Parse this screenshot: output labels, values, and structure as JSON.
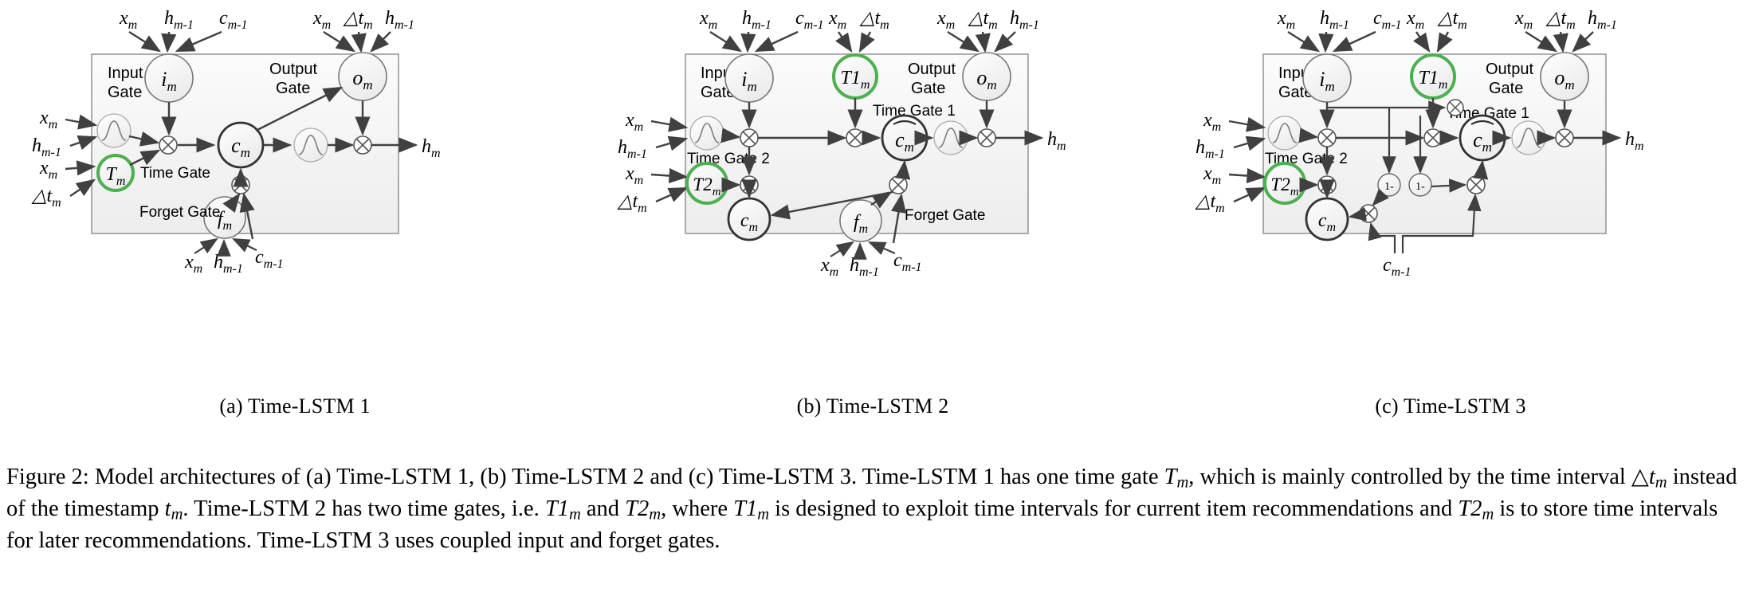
{
  "figure": {
    "number": "Figure 2:",
    "caption_text": "Model architectures of (a) Time-LSTM 1, (b) Time-LSTM 2 and (c) Time-LSTM 3. Time-LSTM 1 has one time gate Tm, which is mainly controlled by the time interval △tm instead of the timestamp tm. Time-LSTM 2 has two time gates, i.e. T1m and T2m, where T1m is designed to exploit time intervals for current item recommendations and T2m is to store time intervals for later recommendations. Time-LSTM 3 uses coupled input and forget gates.",
    "caption_segments": [
      {
        "t": "Figure 2: Model architectures of (a) Time-LSTM 1, (b) Time-LSTM 2 and (c) Time-LSTM 3. Time-LSTM 1 has one time gate ",
        "i": false
      },
      {
        "t": "T",
        "i": true
      },
      {
        "t": "m",
        "sub": true
      },
      {
        "t": ", which is mainly controlled by the time interval ",
        "i": false
      },
      {
        "t": "△t",
        "i": true
      },
      {
        "t": "m",
        "sub": true
      },
      {
        "t": " instead of the timestamp ",
        "i": false
      },
      {
        "t": "t",
        "i": true
      },
      {
        "t": "m",
        "sub": true
      },
      {
        "t": ". Time-LSTM 2 has two time gates, i.e. ",
        "i": false
      },
      {
        "t": "T1",
        "i": true
      },
      {
        "t": "m",
        "sub": true
      },
      {
        "t": " and ",
        "i": false
      },
      {
        "t": "T2",
        "i": true
      },
      {
        "t": "m",
        "sub": true
      },
      {
        "t": ", where ",
        "i": false
      },
      {
        "t": "T1",
        "i": true
      },
      {
        "t": "m",
        "sub": true
      },
      {
        "t": " is designed to exploit time intervals for current item recommendations and ",
        "i": false
      },
      {
        "t": "T2",
        "i": true
      },
      {
        "t": "m",
        "sub": true
      },
      {
        "t": " is to store time intervals for later recommendations. Time-LSTM 3 uses coupled input and forget gates.",
        "i": false
      }
    ]
  },
  "colors": {
    "green_highlight": "#4caf50",
    "cell_fill": "#f2f2f2",
    "node_stroke": "#595959",
    "arrow": "#404040",
    "cell_border": "#808080"
  },
  "symbols": {
    "x": "x",
    "h_prev": "h",
    "c_prev": "c",
    "dt": "△t",
    "h_out": "h",
    "sub_m": "m",
    "sub_m1": "m-1",
    "one_minus": "1-",
    "times": "⊗"
  },
  "panels": [
    {
      "id": "a",
      "caption": "(a) Time-LSTM 1",
      "labels": {
        "input_gate": "Input\nGate",
        "input_gate_line1": "Input",
        "input_gate_line2": "Gate",
        "output_gate": "Output\nGate",
        "output_gate_line1": "Output",
        "output_gate_line2": "Gate",
        "time_gate": "Time Gate",
        "forget_gate": "Forget Gate"
      },
      "nodes": {
        "i": "i",
        "o": "o",
        "c": "c",
        "f": "f",
        "T": "T"
      },
      "top_inputs_left": [
        "x",
        "h",
        "c"
      ],
      "top_inputs_right": [
        "x",
        "△t",
        "h"
      ],
      "left_inputs_top": [
        "x",
        "h"
      ],
      "left_inputs_bottom": [
        "x",
        "△t"
      ],
      "bottom_inputs": [
        "x",
        "h",
        "c"
      ],
      "output": "h"
    },
    {
      "id": "b",
      "caption": "(b) Time-LSTM 2",
      "labels": {
        "input_gate_line1": "Input",
        "input_gate_line2": "Gate",
        "output_gate_line1": "Output",
        "output_gate_line2": "Gate",
        "time_gate_1": "Time Gate 1",
        "time_gate_2": "Time Gate 2",
        "forget_gate": "Forget Gate"
      },
      "nodes": {
        "i": "i",
        "o": "o",
        "c_tilde": "c",
        "c": "c",
        "f": "f",
        "T1": "T1",
        "T2": "T2"
      },
      "top_inputs_i": [
        "x",
        "h",
        "c"
      ],
      "top_inputs_T1": [
        "x",
        "△t"
      ],
      "top_inputs_o": [
        "x",
        "△t",
        "h"
      ],
      "left_inputs_top": [
        "x",
        "h"
      ],
      "left_inputs_bottom": [
        "x",
        "△t"
      ],
      "bottom_inputs": [
        "x",
        "h",
        "c"
      ],
      "output": "h"
    },
    {
      "id": "c",
      "caption": "(c) Time-LSTM 3",
      "labels": {
        "input_gate_line1": "Input",
        "input_gate_line2": "Gate",
        "output_gate_line1": "Output",
        "output_gate_line2": "Gate",
        "time_gate_1": "Time Gate 1",
        "time_gate_2": "Time Gate 2"
      },
      "nodes": {
        "i": "i",
        "o": "o",
        "c_tilde": "c",
        "c": "c",
        "T1": "T1",
        "T2": "T2",
        "one_minus_a": "1-",
        "one_minus_b": "1-"
      },
      "top_inputs_i": [
        "x",
        "h",
        "c"
      ],
      "top_inputs_T1": [
        "x",
        "△t"
      ],
      "top_inputs_o": [
        "x",
        "△t",
        "h"
      ],
      "left_inputs_top": [
        "x",
        "h"
      ],
      "left_inputs_bottom": [
        "x",
        "△t"
      ],
      "bottom_inputs": [
        "c"
      ],
      "output": "h"
    }
  ]
}
